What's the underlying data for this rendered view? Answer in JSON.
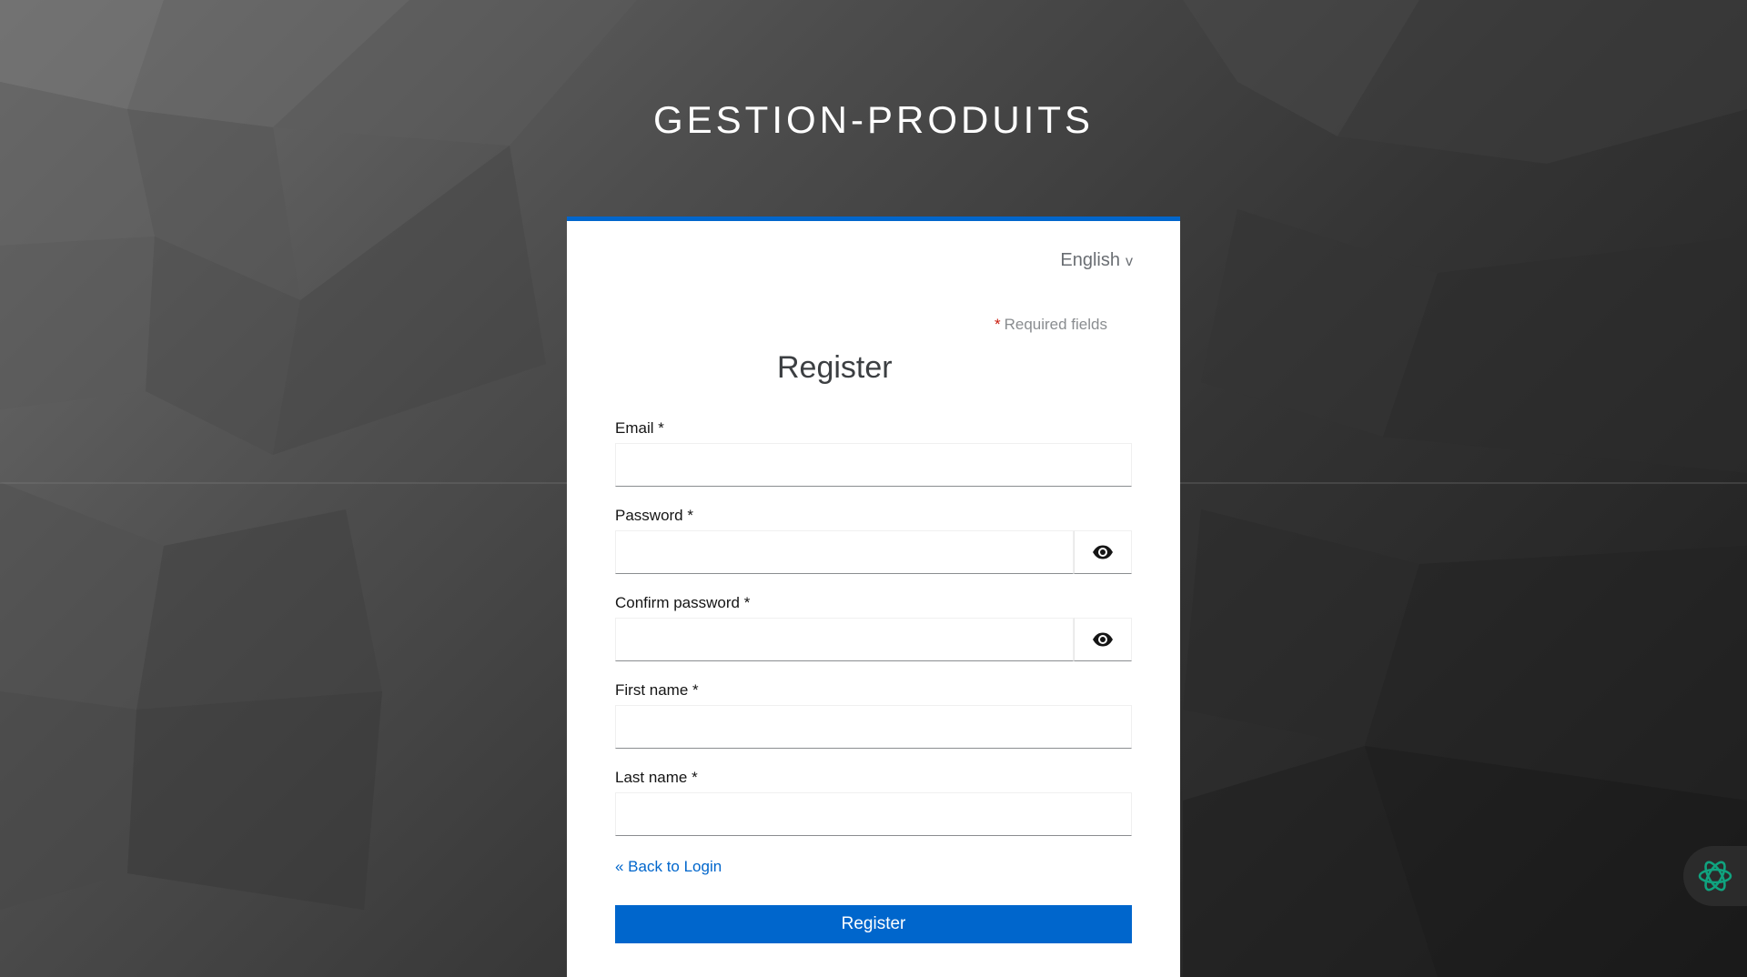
{
  "brand": {
    "title": "GESTION-PRODUITS"
  },
  "locale": {
    "current": "English",
    "chevron": "v"
  },
  "form": {
    "required_star": "*",
    "required_note": "Required fields",
    "title": "Register",
    "fields": {
      "email": {
        "label": "Email *",
        "value": ""
      },
      "password": {
        "label": "Password *",
        "value": ""
      },
      "confirm_password": {
        "label": "Confirm password *",
        "value": ""
      },
      "first_name": {
        "label": "First name *",
        "value": ""
      },
      "last_name": {
        "label": "Last name *",
        "value": ""
      }
    },
    "back_link": "« Back to Login",
    "submit_label": "Register"
  },
  "icons": {
    "password_toggle": "eye-icon",
    "confirm_password_toggle": "eye-icon",
    "assistant": "assistant-knot-icon"
  },
  "colors": {
    "accent": "#0066cc",
    "required_star": "#c9190b",
    "assistant_icon": "#10a37f",
    "card_bg": "#ffffff"
  }
}
